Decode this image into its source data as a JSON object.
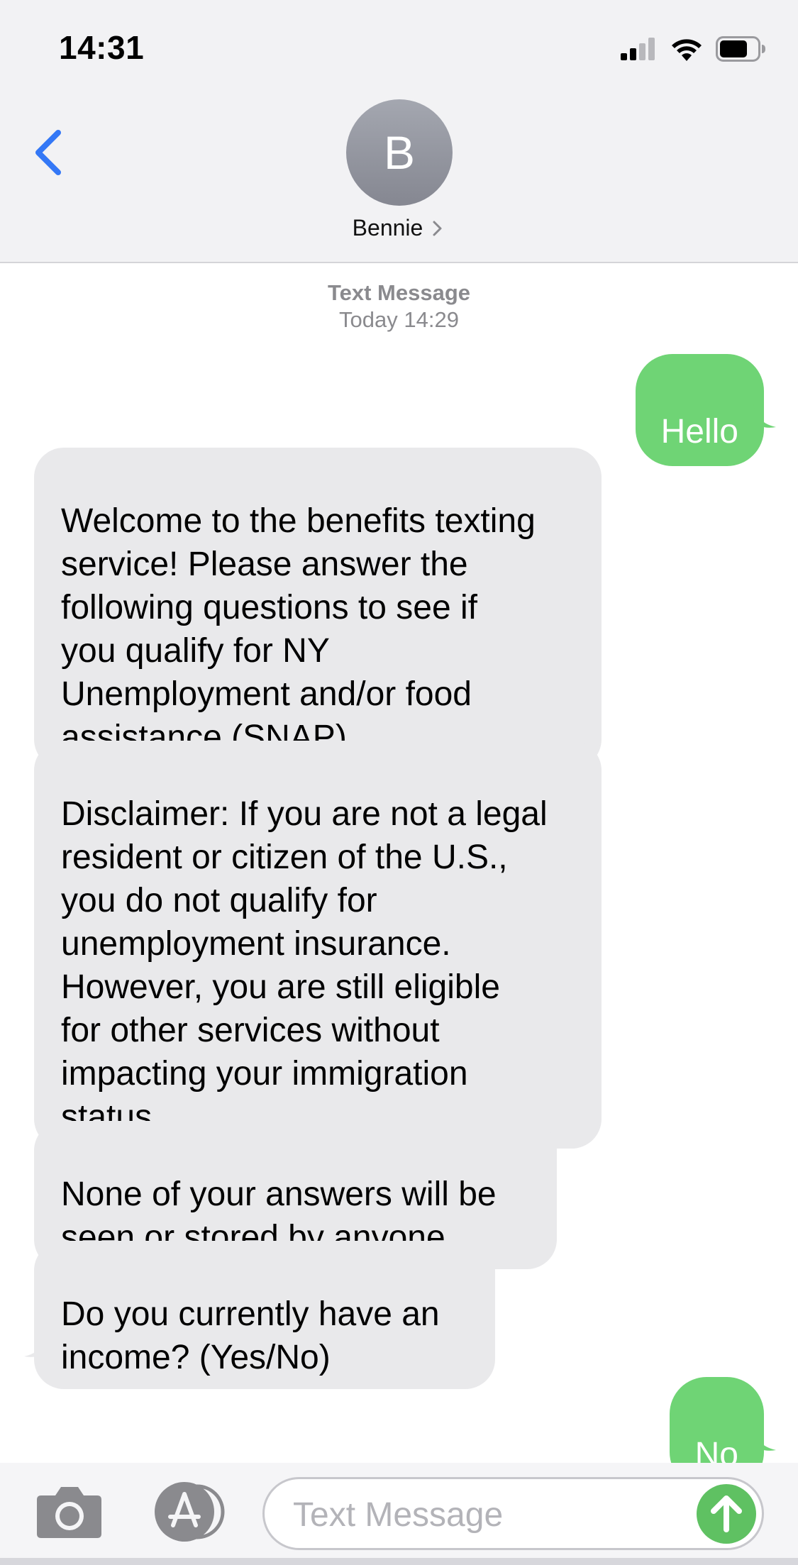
{
  "status_bar": {
    "time": "14:31",
    "icons": [
      "cellular-signal-icon",
      "wifi-icon",
      "battery-icon"
    ]
  },
  "header": {
    "back_icon": "chevron-left-icon",
    "avatar_initial": "B",
    "contact_name": "Bennie",
    "contact_chevron_icon": "chevron-right-icon"
  },
  "conversation": {
    "meta_title": "Text Message",
    "meta_time": "Today 14:29",
    "messages": [
      {
        "direction": "outgoing",
        "text": "Hello"
      },
      {
        "direction": "incoming",
        "text": "Welcome to the benefits texting\nservice! Please answer the\nfollowing questions to see if\nyou qualify for NY\nUnemployment and/or food\nassistance (SNAP)."
      },
      {
        "direction": "incoming",
        "text": "Disclaimer: If you are not a legal\nresident or citizen of the U.S.,\nyou do not qualify for\nunemployment insurance.\nHowever, you are still eligible\nfor other services without\nimpacting your immigration\nstatus."
      },
      {
        "direction": "incoming",
        "text": "None of your answers will be\nseen or stored by anyone."
      },
      {
        "direction": "incoming",
        "text": "Do you currently have an\nincome? (Yes/No)"
      },
      {
        "direction": "outgoing",
        "text": "No"
      }
    ]
  },
  "input_bar": {
    "camera_icon": "camera-icon",
    "apps_icon": "app-store-icon",
    "placeholder": "Text Message",
    "value": "",
    "send_icon": "send-arrow-up-icon"
  },
  "colors": {
    "accent_blue": "#3478f6",
    "outgoing_bubble": "#6fd475",
    "incoming_bubble": "#e9e9eb",
    "send_button": "#5fc162",
    "avatar_gray": "#8e9099"
  }
}
